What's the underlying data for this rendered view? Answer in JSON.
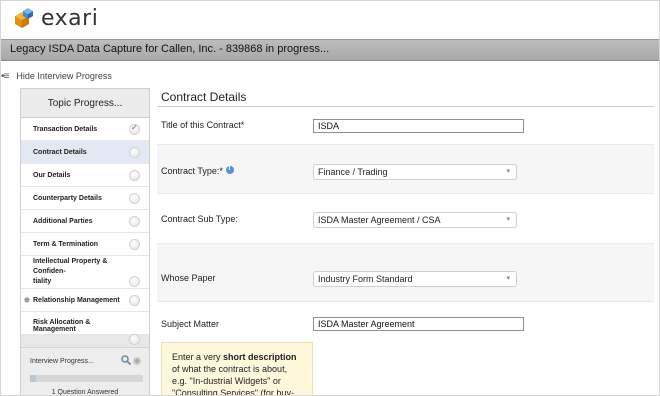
{
  "brand": {
    "name": "exari"
  },
  "window": {
    "title": "Legacy ISDA Data Capture for Callen, Inc. - 839868 in progress..."
  },
  "toggle": {
    "label": "Hide Interview Progress"
  },
  "sidebar": {
    "heading": "Topic Progress...",
    "topics": [
      {
        "label": "Transaction Details",
        "done": true
      },
      {
        "label": "Contract Details",
        "active": true
      },
      {
        "label": "Our Details"
      },
      {
        "label": "Counterparty Details"
      },
      {
        "label": "Additional Parties"
      },
      {
        "label": "Term & Termination"
      },
      {
        "label": "Intellectual Property & Confiden-\ntiality"
      },
      {
        "label": "Relationship Management",
        "expandable": true
      },
      {
        "label": "Risk Allocation & Management"
      }
    ],
    "interview_label": "Interview Progress...",
    "answered_text": "1 Question Answered",
    "progress_fraction": 0.05
  },
  "main": {
    "title": "Contract Details",
    "fields": {
      "title_label": "Title of this Contract*",
      "title_value": "ISDA",
      "type_label": "Contract Type:*",
      "type_value": "Finance / Trading",
      "subtype_label": "Contract Sub Type:",
      "subtype_value": "ISDA Master Agreement / CSA",
      "paper_label": "Whose Paper",
      "paper_value": "Industry Form Standard",
      "subject_label": "Subject Matter",
      "subject_value": "ISDA Master Agreement"
    },
    "help": {
      "prefix": "Enter a very ",
      "bold": "short description",
      "suffix": " of what the contract is about, e.g. \"In-dustrial Widgets\" or \"Consulting Services\" (for buy-side or sell-side"
    }
  },
  "icons": {
    "logo": "exari-cubes-logo",
    "menu": "hamburger-icon",
    "search": "magnifier-icon",
    "settings": "gear-icon",
    "info": "info-icon",
    "select": "chevron-down-icon"
  },
  "colors": {
    "titlebar": "#b3b3b3",
    "active_topic": "#e3e9f2",
    "help_bg": "#fff8dc",
    "info_blue": "#5b8fd6"
  }
}
